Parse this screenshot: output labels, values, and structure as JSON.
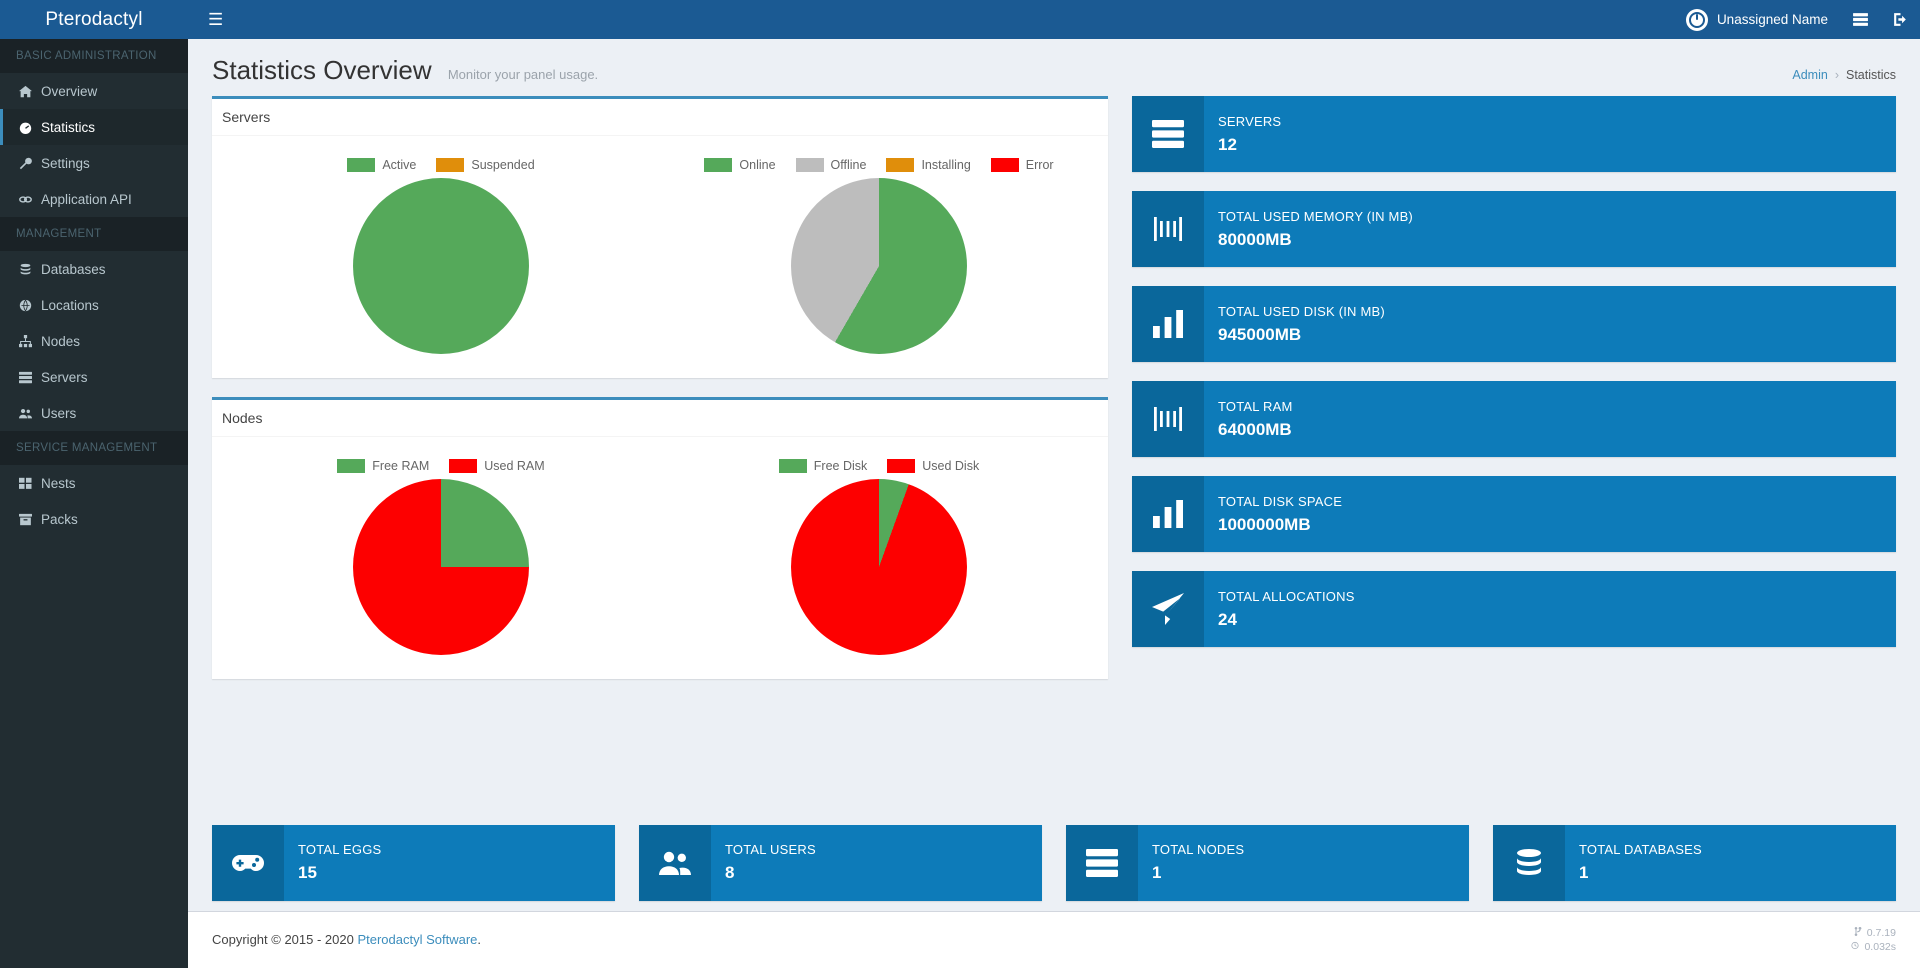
{
  "brand": {
    "name": "Pterodactyl"
  },
  "topbar": {
    "menu_toggle_label": "☰",
    "user_name": "Unassigned Name",
    "servers_icon_name": "server-list-icon",
    "logout_icon_name": "logout-icon"
  },
  "page": {
    "title": "Statistics Overview",
    "subtitle": "Monitor your panel usage.",
    "breadcrumb": {
      "root": "Admin",
      "separator": "›",
      "current": "Statistics"
    }
  },
  "sidebar": {
    "sections": [
      {
        "heading": "BASIC ADMINISTRATION",
        "items": [
          {
            "label": "Overview",
            "icon": "home-icon",
            "active": false
          },
          {
            "label": "Statistics",
            "icon": "dashboard-icon",
            "active": true
          },
          {
            "label": "Settings",
            "icon": "wrench-icon",
            "active": false
          },
          {
            "label": "Application API",
            "icon": "link-icon",
            "active": false
          }
        ]
      },
      {
        "heading": "MANAGEMENT",
        "items": [
          {
            "label": "Databases",
            "icon": "database-icon",
            "active": false
          },
          {
            "label": "Locations",
            "icon": "globe-icon",
            "active": false
          },
          {
            "label": "Nodes",
            "icon": "sitemap-icon",
            "active": false
          },
          {
            "label": "Servers",
            "icon": "server-icon",
            "active": false
          },
          {
            "label": "Users",
            "icon": "users-icon",
            "active": false
          }
        ]
      },
      {
        "heading": "SERVICE MANAGEMENT",
        "items": [
          {
            "label": "Nests",
            "icon": "th-large-icon",
            "active": false
          },
          {
            "label": "Packs",
            "icon": "archive-icon",
            "active": false
          }
        ]
      }
    ]
  },
  "panels": [
    {
      "title": "Servers"
    },
    {
      "title": "Nodes"
    }
  ],
  "colors": {
    "green": "#55a95a",
    "orange": "#e08e0b",
    "gray": "#bdbdbd",
    "red": "#fd0000",
    "accent": "#3c8dbc",
    "card": "#0d7bb9",
    "card_icon": "#0a5e8c"
  },
  "chart_data": [
    {
      "type": "pie",
      "title": "Servers",
      "panel": "Servers",
      "chart_name": "servers-status-pie",
      "legend_position": "top",
      "labels": [
        "Active",
        "Suspended"
      ],
      "values": [
        12,
        0
      ],
      "colors": [
        "#55a95a",
        "#e08e0b"
      ]
    },
    {
      "type": "pie",
      "title": "Servers",
      "panel": "Servers",
      "chart_name": "servers-state-pie",
      "legend_position": "top",
      "labels": [
        "Online",
        "Offline",
        "Installing",
        "Error"
      ],
      "values": [
        7,
        5,
        0,
        0
      ],
      "colors": [
        "#55a95a",
        "#bdbdbd",
        "#e08e0b",
        "#fd0000"
      ]
    },
    {
      "type": "pie",
      "title": "Nodes",
      "panel": "Nodes",
      "chart_name": "nodes-ram-pie",
      "legend_position": "top",
      "labels": [
        "Free RAM",
        "Used RAM"
      ],
      "values": [
        16000,
        48000
      ],
      "colors": [
        "#55a95a",
        "#fd0000"
      ]
    },
    {
      "type": "pie",
      "title": "Nodes",
      "panel": "Nodes",
      "chart_name": "nodes-disk-pie",
      "legend_position": "top",
      "labels": [
        "Free Disk",
        "Used Disk"
      ],
      "values": [
        55000,
        945000
      ],
      "colors": [
        "#55a95a",
        "#fd0000"
      ]
    }
  ],
  "stats_right": [
    {
      "label": "SERVERS",
      "value": "12",
      "icon": "server-rack-icon"
    },
    {
      "label": "TOTAL USED MEMORY (IN MB)",
      "value": "80000MB",
      "icon": "memory-icon"
    },
    {
      "label": "TOTAL USED DISK (IN MB)",
      "value": "945000MB",
      "icon": "bar-chart-icon"
    },
    {
      "label": "TOTAL RAM",
      "value": "64000MB",
      "icon": "memory-icon"
    },
    {
      "label": "TOTAL DISK SPACE",
      "value": "1000000MB",
      "icon": "bar-chart-icon"
    },
    {
      "label": "TOTAL ALLOCATIONS",
      "value": "24",
      "icon": "paper-plane-icon"
    }
  ],
  "stats_bottom": [
    {
      "label": "TOTAL EGGS",
      "value": "15",
      "icon": "gamepad-icon"
    },
    {
      "label": "TOTAL USERS",
      "value": "8",
      "icon": "users-icon"
    },
    {
      "label": "TOTAL NODES",
      "value": "1",
      "icon": "server-rack-icon"
    },
    {
      "label": "TOTAL DATABASES",
      "value": "1",
      "icon": "database-icon"
    }
  ],
  "footer": {
    "copyright_prefix": "Copyright © 2015 - 2020 ",
    "link_text": "Pterodactyl Software",
    "copyright_suffix": ".",
    "version": "0.7.19",
    "load_time": "0.032s",
    "version_icon": "branch-icon",
    "time_icon": "clock-icon"
  }
}
